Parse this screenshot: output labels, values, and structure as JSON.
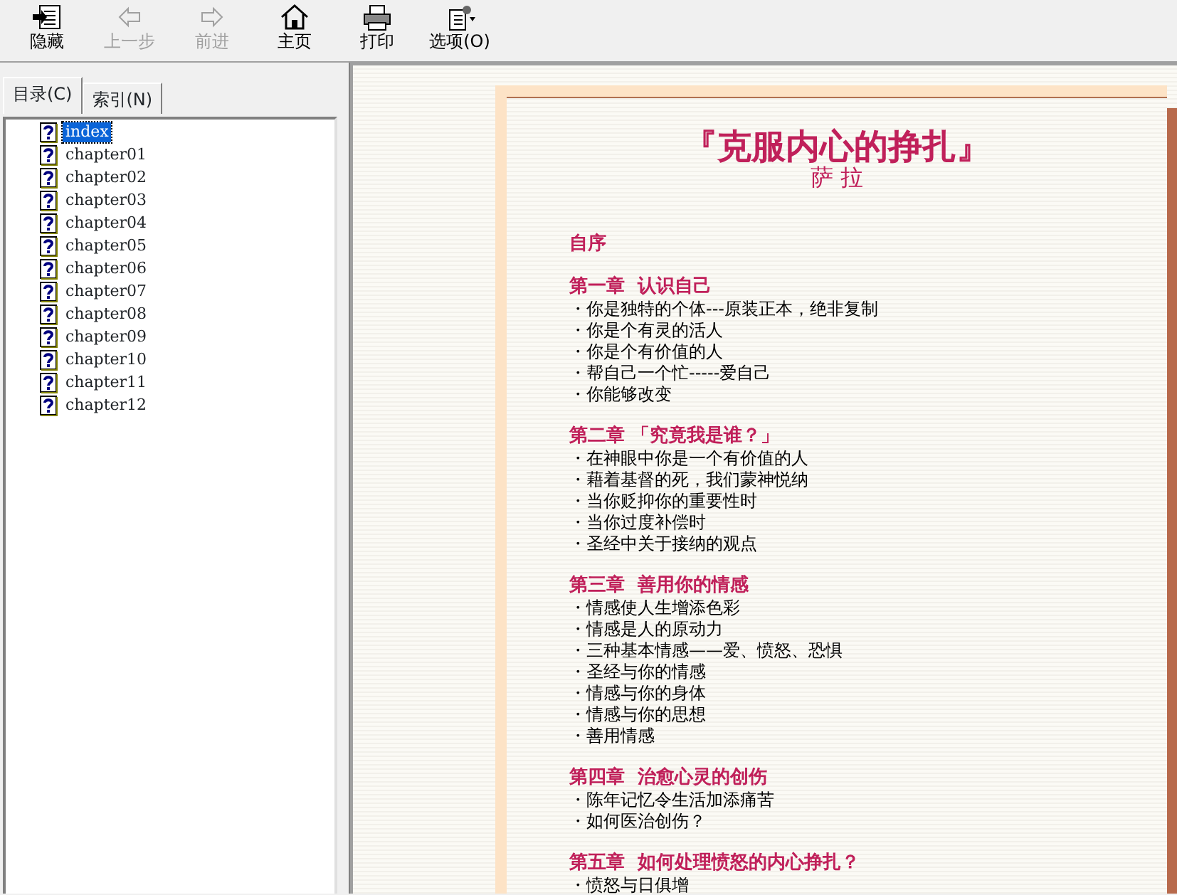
{
  "toolbar": [
    {
      "label": "隐藏",
      "disabled": false
    },
    {
      "label": "上一步",
      "disabled": true
    },
    {
      "label": "前进",
      "disabled": true
    },
    {
      "label": "主页",
      "disabled": false
    },
    {
      "label": "打印",
      "disabled": false
    },
    {
      "label": "选项(O)",
      "disabled": false
    }
  ],
  "tabs": [
    {
      "label": "目录(C)",
      "selected": true
    },
    {
      "label": "索引(N)",
      "selected": false
    }
  ],
  "tree": [
    {
      "label": "index",
      "selected": true
    },
    {
      "label": "chapter01",
      "selected": false
    },
    {
      "label": "chapter02",
      "selected": false
    },
    {
      "label": "chapter03",
      "selected": false
    },
    {
      "label": "chapter04",
      "selected": false
    },
    {
      "label": "chapter05",
      "selected": false
    },
    {
      "label": "chapter06",
      "selected": false
    },
    {
      "label": "chapter07",
      "selected": false
    },
    {
      "label": "chapter08",
      "selected": false
    },
    {
      "label": "chapter09",
      "selected": false
    },
    {
      "label": "chapter10",
      "selected": false
    },
    {
      "label": "chapter11",
      "selected": false
    },
    {
      "label": "chapter12",
      "selected": false
    }
  ],
  "document": {
    "title": "『克服内心的挣扎』",
    "author": "萨 拉",
    "sections": [
      {
        "heading": "自序"
      },
      {
        "heading": "第一章  认识自己",
        "items": [
          "・你是独特的个体---原装正本，绝非复制",
          "・你是个有灵的活人",
          "・你是个有价值的人",
          "・帮自己一个忙-----爱自己",
          "・你能够改变"
        ]
      },
      {
        "heading": "第二章 「究竟我是谁？」",
        "items": [
          "・在神眼中你是一个有价值的人",
          "・藉着基督的死，我们蒙神悦纳",
          "・当你贬抑你的重要性时",
          "・当你过度补偿时",
          "・圣经中关于接纳的观点"
        ]
      },
      {
        "heading": "第三章  善用你的情感",
        "items": [
          "・情感使人生增添色彩",
          "・情感是人的原动力",
          "・三种基本情感——爱、愤怒、恐惧",
          "・圣经与你的情感",
          "・情感与你的身体",
          "・情感与你的思想",
          "・善用情感"
        ]
      },
      {
        "heading": "第四章  治愈心灵的创伤",
        "items": [
          "・陈年记忆令生活加添痛苦",
          "・如何医治创伤？"
        ]
      },
      {
        "heading": "第五章  如何处理愤怒的内心挣扎？",
        "items": [
          "・愤怒与日俱增"
        ]
      }
    ]
  }
}
